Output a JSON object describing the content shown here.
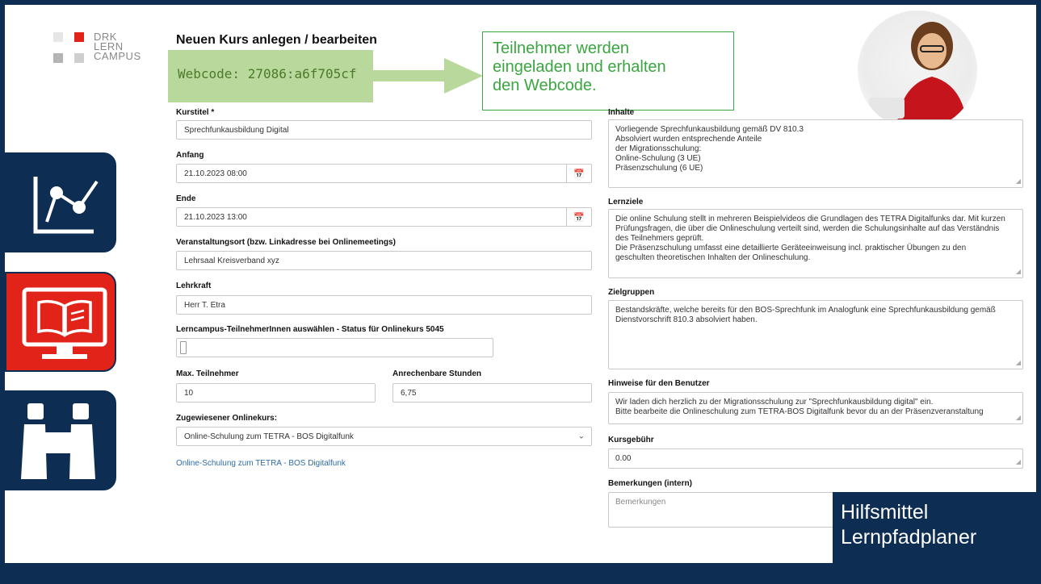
{
  "logo": {
    "line1": "DRK",
    "line2": "LERN",
    "line3": "CAMPUS"
  },
  "form": {
    "title": "Neuen Kurs anlegen / bearbeiten",
    "webcode": "Webcode: 27086:a6f705cf",
    "kurstitel_label": "Kurstitel *",
    "kurstitel_value": "Sprechfunkausbildung Digital",
    "anfang_label": "Anfang",
    "anfang_value": "21.10.2023 08:00",
    "ende_label": "Ende",
    "ende_value": "21.10.2023 13:00",
    "ort_label": "Veranstaltungsort (bzw. Linkadresse bei Onlinemeetings)",
    "ort_value": "Lehrsaal Kreisverband xyz",
    "lehrkraft_label": "Lehrkraft",
    "lehrkraft_value": "Herr T. Etra",
    "teilnehmer_label": "Lerncampus-TeilnehmerInnen auswählen - Status für Onlinekurs 5045",
    "max_label": "Max. Teilnehmer",
    "max_value": "10",
    "stunden_label": "Anrechenbare Stunden",
    "stunden_value": "6,75",
    "onlinekurs_label": "Zugewiesener Onlinekurs:",
    "onlinekurs_value": "Online-Schulung zum TETRA - BOS Digitalfunk",
    "onlinekurs_link": "Online-Schulung zum TETRA - BOS Digitalfunk"
  },
  "callout": {
    "l1": "Teilnehmer werden",
    "l2": "eingeladen und erhalten",
    "l3": "den Webcode."
  },
  "right": {
    "inhalte_label": "Inhalte",
    "inhalte_lines": [
      "Vorliegende Sprechfunkausbildung gemäß DV 810.3",
      "Absolviert wurden entsprechende Anteile",
      "der Migrationsschulung:",
      "Online-Schulung (3 UE)",
      "Präsenzschulung (6 UE)"
    ],
    "lernziele_label": "Lernziele",
    "lernziele_lines": [
      "Die online Schulung stellt in mehreren Beispielvideos die Grundlagen des TETRA Digitalfunks dar. Mit kurzen",
      "Prüfungsfragen, die über die Onlineschulung verteilt sind, werden die Schulungsinhalte auf das Verständnis",
      "des Teilnehmers geprüft.",
      "Die Präsenzschulung umfasst eine detaillierte Geräteeinweisung incl. praktischer Übungen zu den",
      "geschulten theoretischen Inhalten der Onlineschulung."
    ],
    "zielgruppen_label": "Zielgruppen",
    "zielgruppen_lines": [
      "Bestandskräfte, welche bereits für den BOS-Sprechfunk im Analogfunk eine Sprechfunkausbildung gemäß",
      "Dienstvorschrift 810.3 absolviert haben."
    ],
    "hinweise_label": "Hinweise für den Benutzer",
    "hinweise_lines": [
      "Wir laden dich herzlich zu der Migrationsschulung zur \"Sprechfunkausbildung digital\" ein.",
      "Bitte bearbeite die Onlineschulung zum TETRA-BOS Digitalfunk bevor du an der Präsenzveranstaltung"
    ],
    "gebuehr_label": "Kursgebühr",
    "gebuehr_value": "0.00",
    "bemerkungen_label": "Bemerkungen (intern)",
    "bemerkungen_placeholder": "Bemerkungen"
  },
  "badge": {
    "l1": "Hilfsmittel",
    "l2": "Lernpfadplaner"
  },
  "colors": {
    "navy": "#0d2d52",
    "red": "#e2231a",
    "green": "#3aa640",
    "webcode_bg": "#b9d89c"
  },
  "icons": [
    "chart-line-icon",
    "monitor-book-icon",
    "binoculars-icon",
    "calendar-icon",
    "chevron-down-icon"
  ]
}
